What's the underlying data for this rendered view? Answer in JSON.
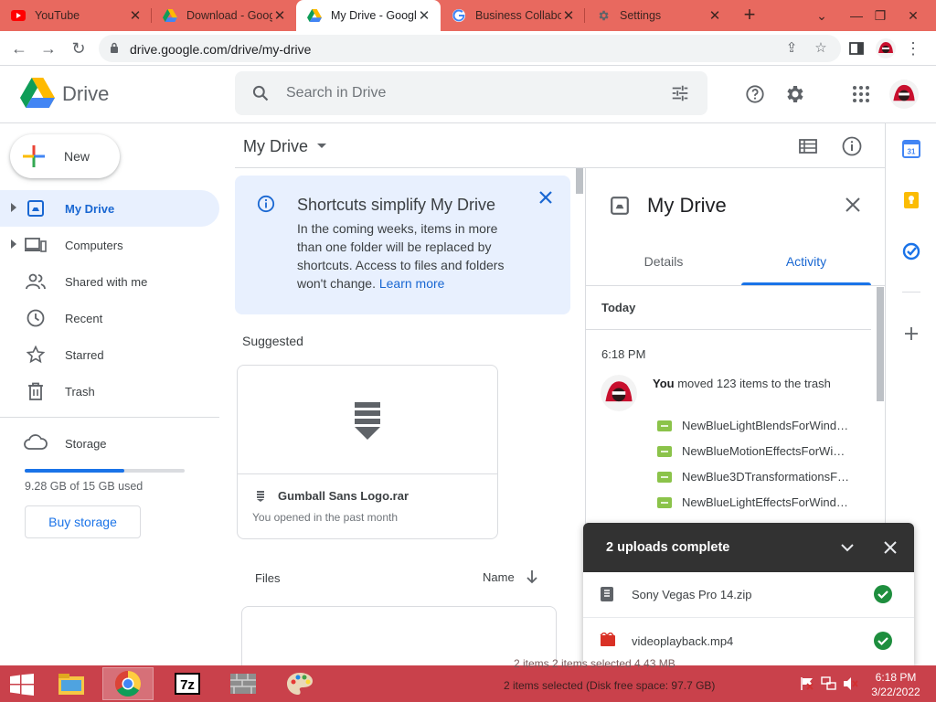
{
  "browser": {
    "tabs": [
      {
        "title": "YouTube",
        "icon": "youtube-icon"
      },
      {
        "title": "Download - Goog",
        "icon": "drive-icon"
      },
      {
        "title": "My Drive - Googl",
        "icon": "drive-icon",
        "active": true
      },
      {
        "title": "Business Collabo",
        "icon": "google-icon"
      },
      {
        "title": "Settings",
        "icon": "gear-icon"
      }
    ],
    "url": "drive.google.com/drive/my-drive"
  },
  "header": {
    "logo_text": "Drive",
    "search_placeholder": "Search in Drive"
  },
  "sidebar": {
    "new_label": "New",
    "items": [
      {
        "label": "My Drive",
        "icon": "my-drive-icon",
        "active": true
      },
      {
        "label": "Computers",
        "icon": "computers-icon"
      },
      {
        "label": "Shared with me",
        "icon": "shared-icon"
      },
      {
        "label": "Recent",
        "icon": "clock-icon"
      },
      {
        "label": "Starred",
        "icon": "star-icon"
      },
      {
        "label": "Trash",
        "icon": "trash-icon"
      }
    ],
    "storage_label": "Storage",
    "storage_used": "9.28 GB of 15 GB used",
    "storage_fraction": 0.62,
    "buy_label": "Buy storage"
  },
  "main": {
    "title": "My Drive",
    "banner": {
      "title": "Shortcuts simplify My Drive",
      "text": "In the coming weeks, items in more than one folder will be replaced by shortcuts. Access to files and folders won't change. ",
      "link": "Learn more"
    },
    "suggested_label": "Suggested",
    "suggested_file": {
      "name": "Gumball Sans Logo.rar",
      "sub": "You opened in the past month"
    },
    "files_label": "Files",
    "sort_label": "Name"
  },
  "details": {
    "title": "My Drive",
    "tabs": [
      "Details",
      "Activity"
    ],
    "active_tab": "Activity",
    "today_label": "Today",
    "time": "6:18 PM",
    "actor": "You",
    "action": " moved 123 items to the trash",
    "files": [
      "NewBlueLightBlendsForWind…",
      "NewBlueMotionEffectsForWi…",
      "NewBlue3DTransformationsF…",
      "NewBlueLightEffectsForWind…"
    ]
  },
  "uploads": {
    "title": "2 uploads complete",
    "items": [
      {
        "name": "Sony Vegas Pro 14.zip",
        "icon": "archive-file-icon"
      },
      {
        "name": "videoplayback.mp4",
        "icon": "video-file-icon"
      }
    ]
  },
  "taskbar": {
    "status": "2 items selected (Disk free space: 97.7 GB)",
    "status_behind": "2 items     2 items selected   4.43 MB",
    "time": "6:18 PM",
    "date": "3/22/2022"
  },
  "colors": {
    "accent": "#1a73e8",
    "tabstrip": "#e8695f",
    "taskbar": "#c9414b",
    "success": "#1e8e3e"
  }
}
